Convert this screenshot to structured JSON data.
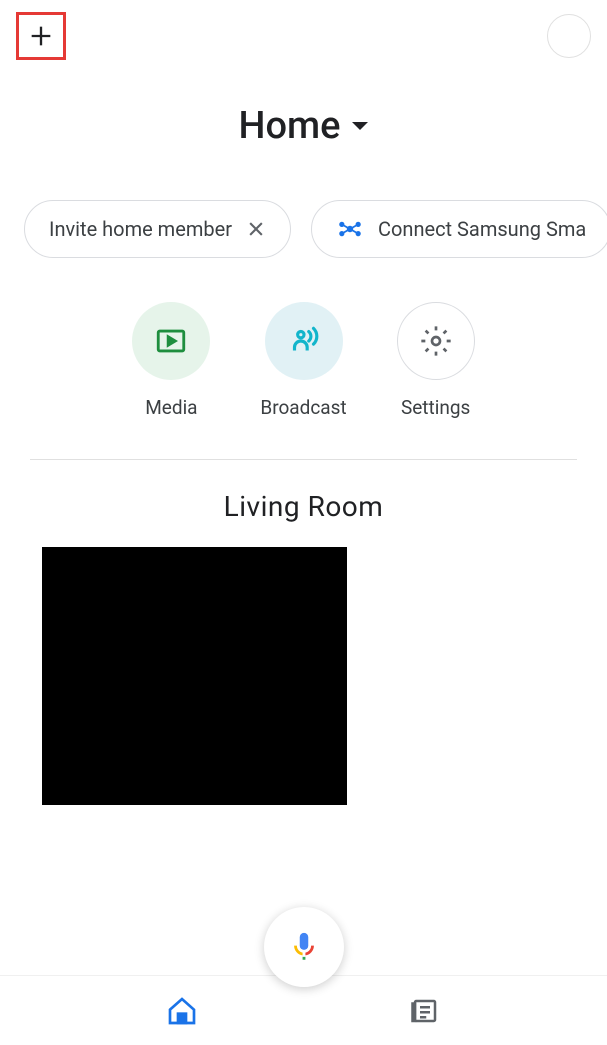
{
  "header": {
    "title": "Home"
  },
  "chips": [
    {
      "label": "Invite home member",
      "hasClose": true,
      "hasIcon": false
    },
    {
      "label": "Connect Samsung Sma",
      "hasClose": false,
      "hasIcon": true
    }
  ],
  "actions": [
    {
      "label": "Media",
      "type": "media"
    },
    {
      "label": "Broadcast",
      "type": "broadcast"
    },
    {
      "label": "Settings",
      "type": "settings"
    }
  ],
  "rooms": [
    {
      "name": "Living Room"
    }
  ],
  "colors": {
    "highlight": "#e53935",
    "mediaIcon": "#1e8e3e",
    "broadcastIcon": "#12b5cb",
    "settingsIcon": "#5f6368",
    "navActive": "#1a73e8",
    "navInactive": "#5f6368"
  }
}
